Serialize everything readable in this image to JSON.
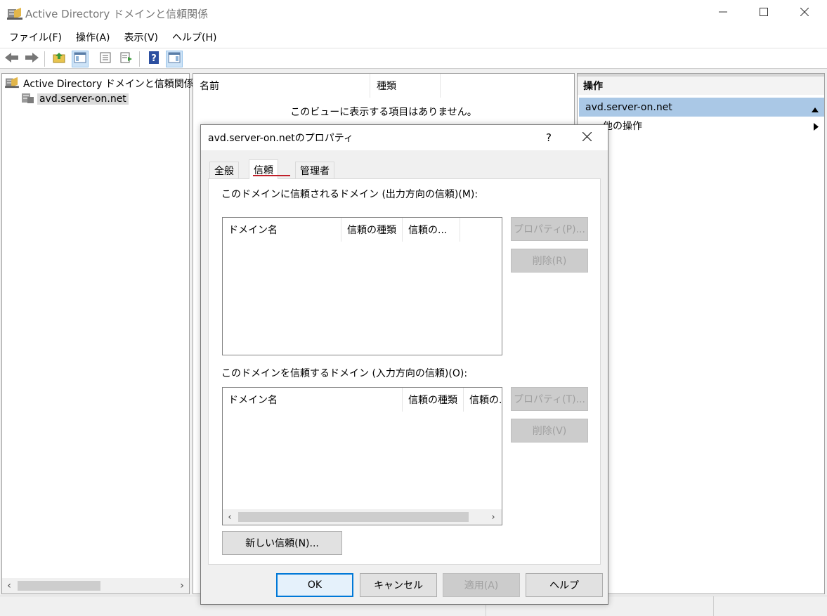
{
  "window": {
    "title": "Active Directory ドメインと信頼関係"
  },
  "menu": {
    "file": "ファイル(F)",
    "action": "操作(A)",
    "view": "表示(V)",
    "help": "ヘルプ(H)"
  },
  "tree": {
    "root_label": "Active Directory ドメインと信頼関係 [ A",
    "child_label": "avd.server-on.net"
  },
  "list": {
    "col_name": "名前",
    "col_type": "種類",
    "empty_message": "このビューに表示する項目はありません。"
  },
  "actions": {
    "header": "操作",
    "section": "avd.server-on.net",
    "more_actions": "他の操作"
  },
  "dialog": {
    "title": "avd.server-on.netのプロパティ",
    "help_glyph": "?",
    "tabs": [
      {
        "label": "全般"
      },
      {
        "label": "信頼"
      },
      {
        "label": "管理者"
      }
    ],
    "outgoing": {
      "label": "このドメインに信頼されるドメイン (出力方向の信頼)(M):",
      "columns": [
        "ドメイン名",
        "信頼の種類",
        "信頼の..."
      ],
      "properties_button": "プロパティ(P)...",
      "remove_button": "削除(R)"
    },
    "incoming": {
      "label": "このドメインを信頼するドメイン (入力方向の信頼)(O):",
      "columns": [
        "ドメイン名",
        "信頼の種類",
        "信頼の."
      ],
      "properties_button": "プロパティ(T)...",
      "remove_button": "削除(V)"
    },
    "new_trust_button": "新しい信頼(N)...",
    "ok_button": "OK",
    "cancel_button": "キャンセル",
    "apply_button": "適用(A)",
    "help_button": "ヘルプ"
  },
  "colors": {
    "selection_blue": "#aac8e6",
    "tab_underline": "#c0202a",
    "default_button_border": "#0078d7"
  }
}
